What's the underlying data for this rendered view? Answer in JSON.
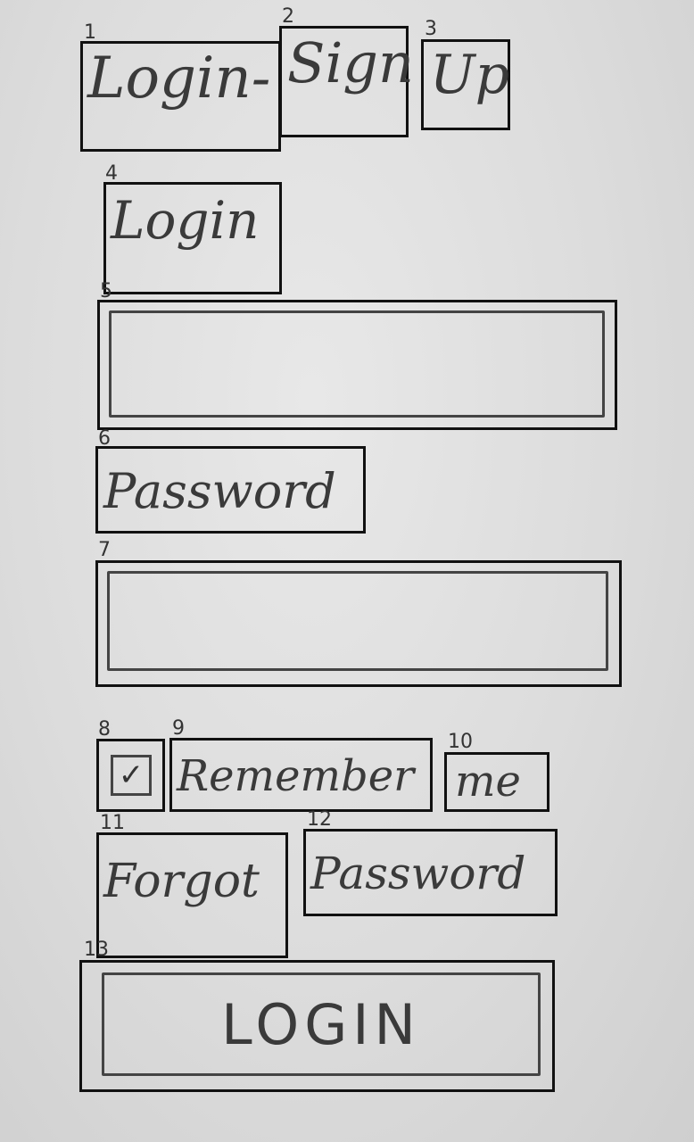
{
  "annotations": [
    "1",
    "2",
    "3",
    "4",
    "5",
    "6",
    "7",
    "8",
    "9",
    "10",
    "11",
    "12",
    "13"
  ],
  "title": {
    "word1": "Login-",
    "word2": "Sign",
    "word3": "Up"
  },
  "login_label": "Login",
  "password_label": "Password",
  "remember": {
    "checkbox_mark": "✓",
    "word1": "Remember",
    "word2": "me"
  },
  "forgot": {
    "word1": "Forgot",
    "word2": "Password"
  },
  "login_button_label": "LOGIN"
}
